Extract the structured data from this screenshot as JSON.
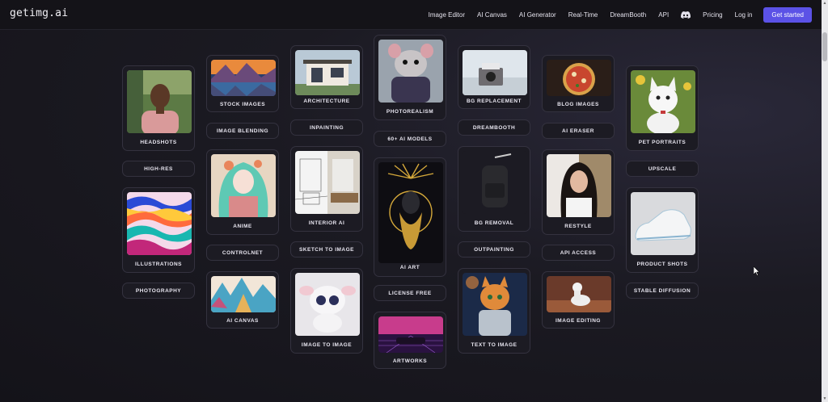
{
  "brand": {
    "logo": "getimg.ai",
    "accent": "#5b52e6"
  },
  "nav": {
    "items": [
      "Image Editor",
      "AI Canvas",
      "AI Generator",
      "Real-Time",
      "DreamBooth",
      "API",
      "Pricing",
      "Log in"
    ],
    "discord_icon": "discord-icon",
    "cta": "Get started"
  },
  "tiles": {
    "headshots": "HEADSHOTS",
    "high_res": "HIGH-RES",
    "illustrations": "ILLUSTRATIONS",
    "photography": "PHOTOGRAPHY",
    "stock_images": "STOCK IMAGES",
    "image_blending": "IMAGE BLENDING",
    "anime": "ANIME",
    "controlnet": "CONTROLNET",
    "ai_canvas": "AI CANVAS",
    "architecture": "ARCHITECTURE",
    "inpainting": "INPAINTING",
    "interior_ai": "INTERIOR AI",
    "sketch_to_image": "SKETCH TO IMAGE",
    "image_to_image": "IMAGE TO IMAGE",
    "photorealism": "PHOTOREALISM",
    "ai_models": "60+ AI MODELS",
    "ai_art": "AI ART",
    "license_free": "LICENSE FREE",
    "artworks": "ARTWORKS",
    "bg_replacement": "BG REPLACEMENT",
    "dreambooth": "DREAMBOOTH",
    "bg_removal": "BG REMOVAL",
    "outpainting": "OUTPAINTING",
    "text_to_image": "TEXT TO IMAGE",
    "blog_images": "BLOG IMAGES",
    "ai_eraser": "AI ERASER",
    "restyle": "RESTYLE",
    "api_access": "API ACCESS",
    "image_editing": "IMAGE EDITING",
    "pet_portraits": "PET PORTRAITS",
    "upscale": "UPSCALE",
    "product_shots": "PRODUCT SHOTS",
    "stable_diffusion": "STABLE DIFFUSION"
  }
}
